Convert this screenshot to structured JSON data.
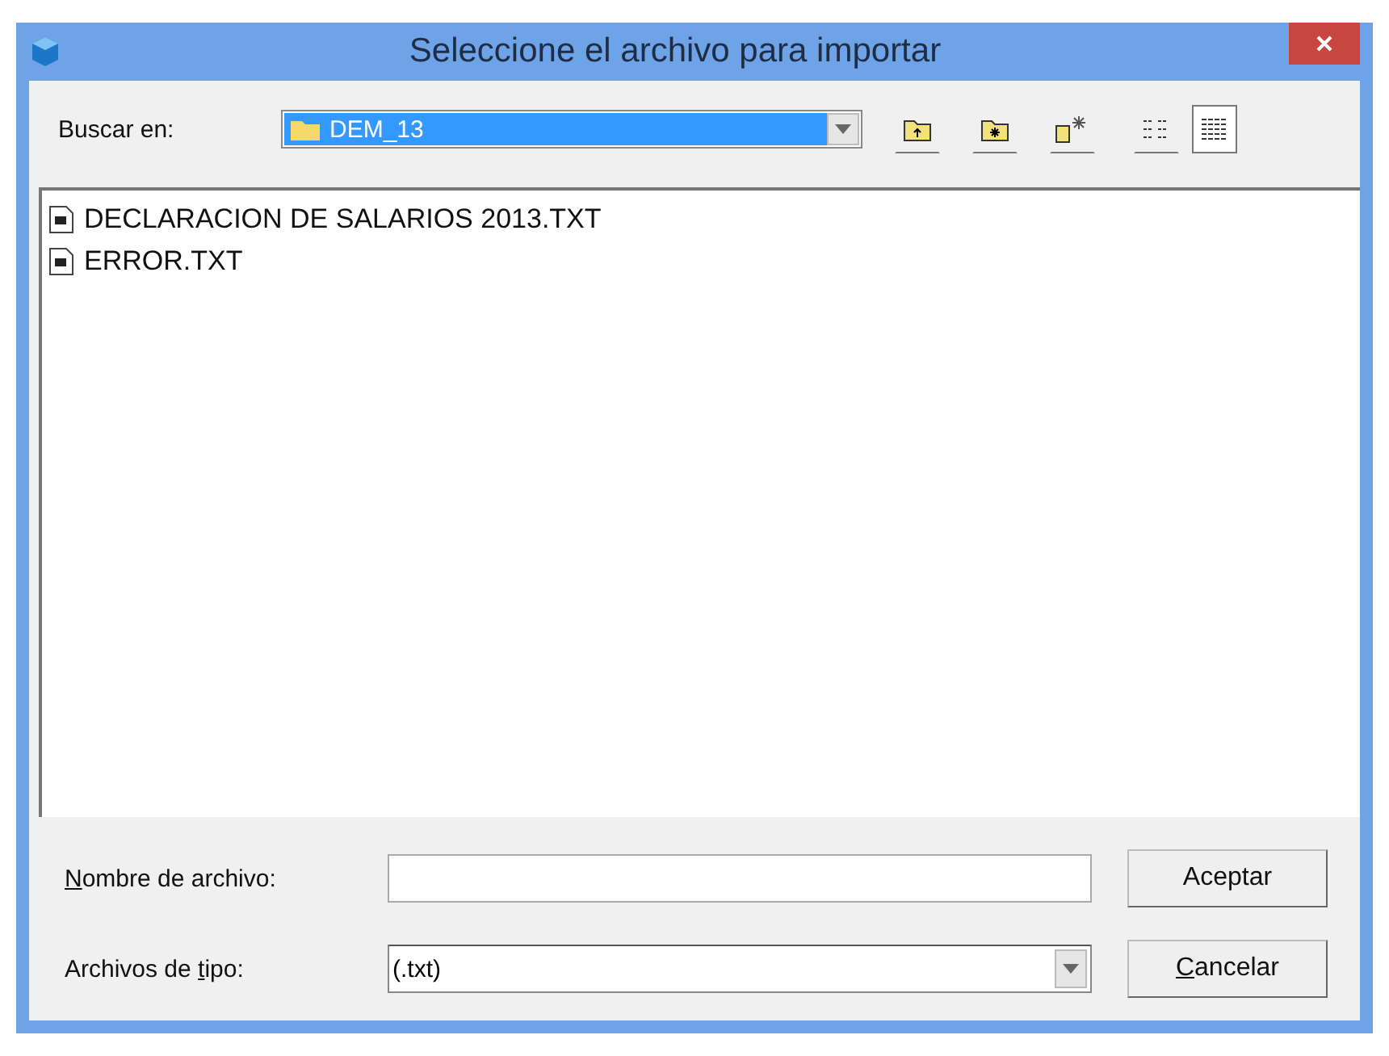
{
  "window": {
    "title": "Seleccione el archivo para importar"
  },
  "look_in": {
    "label": "Buscar en:",
    "value": "DEM_13"
  },
  "files": [
    {
      "name": "DECLARACION DE SALARIOS 2013.TXT"
    },
    {
      "name": "ERROR.TXT"
    }
  ],
  "view_buttons": [
    {
      "kind": "list",
      "selected": false
    },
    {
      "kind": "details",
      "selected": true
    }
  ],
  "file_name": {
    "label": {
      "key": "N",
      "after": "ombre de archivo:"
    }
  },
  "file_type": {
    "label": {
      "before": "Archivos de ",
      "key": "t",
      "after": "ipo:"
    },
    "value": "(.txt)"
  },
  "buttons": [
    {
      "label": {
        "after": "Aceptar"
      }
    },
    {
      "label": {
        "key": "C",
        "after": "ancelar"
      }
    }
  ]
}
